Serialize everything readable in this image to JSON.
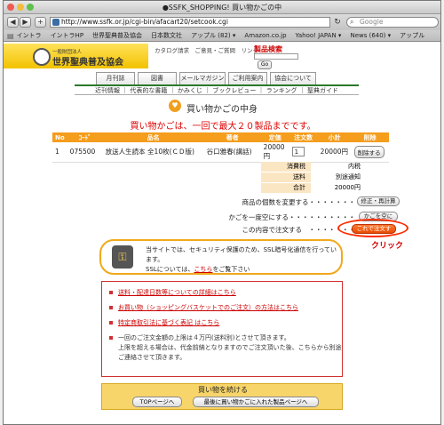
{
  "browser": {
    "window_title": "●SSFK_SHOPPING!  買い物かごの中",
    "url": "http://www.ssfk.or.jp/cgi-bin/afacart20/setcook.cgi",
    "search_placeholder": "Google",
    "back_label": "◀",
    "forward_label": "▶",
    "add_label": "+",
    "reload_label": "↻",
    "bookmarks": [
      "イントラ",
      "イントラHP",
      "世界聖典普及協会",
      "日本数文社",
      "アップル (82) ▾",
      "Amazon.co.jp",
      "Yahoo! JAPAN ▾",
      "News (640) ▾",
      "アップル"
    ]
  },
  "site": {
    "logo_small": "一般財団法人",
    "logo_main": "世界聖典普及協会",
    "header_links": "カタログ請求　ご意見・ご質問　リンク",
    "search_label": "製品検索",
    "search_go": "Go",
    "nav_tabs": [
      "月刊誌",
      "図書",
      "メールマガジン",
      "ご利用案内",
      "協会について"
    ],
    "subnav": "近刊情報 ｜ 代表的な書籍 ｜ かみくじ ｜ ブックレビュー ｜ ランキング ｜ 聖典ガイド"
  },
  "page": {
    "title": "買い物かごの中身",
    "title_icon": "♥",
    "note": "買い物かごは、一回で最大２０製品までです。"
  },
  "cart": {
    "headers": [
      "No",
      "ｺｰﾄﾞ",
      "品名",
      "著者",
      "定価",
      "注文数",
      "小計",
      "削除"
    ],
    "items": [
      {
        "no": "1",
        "code": "075500",
        "name": "放送人生読本 全10枚(ＣＤ版)",
        "author": "谷口雅春(講話)",
        "price": "20000円",
        "qty": "1",
        "subtotal": "20000円",
        "delete": "削除する"
      }
    ],
    "summary": [
      {
        "label": "消費税",
        "value": "内税"
      },
      {
        "label": "送料",
        "value": "別途通知"
      },
      {
        "label": "合計",
        "value": "20000円"
      }
    ]
  },
  "actions": {
    "change_text": "商品の個数を変更する・・・・・・・",
    "change_btn": "修正・再計算",
    "empty_text": "かごを一度空にする・・・・・・・・・・",
    "empty_btn": "かごを空に",
    "order_text": "この内容で注文する　・・・・・・・",
    "order_btn": "これで注文する",
    "click_label": "クリック"
  },
  "security": {
    "line1": "当サイトでは、セキュリティ保護のため、SSL暗号化通信を行っています。",
    "line2_prefix": "SSLについては、",
    "line2_link": "こちら",
    "line2_suffix": "をご覧下さい"
  },
  "notes": {
    "item1": "送料・配達日数等についての詳細はこちら",
    "item2": "お買い物（ショッピングバスケットでのご注文）の方法はこちら",
    "item3": "特定商取引法に基づく表記 はこちら",
    "item4_line1": "一回のご注文金額の上限は４万円(送料別)とさせて頂きます。",
    "item4_line2": "上限を超える場合は、代金前納となりますのでご注文頂いた後、こちらから別途",
    "item4_line3": "ご連絡させて頂きます。"
  },
  "continue": {
    "title": "買い物を続ける",
    "top_btn": "TOPページへ",
    "last_btn": "最後に買い物かごに入れた製品ページへ"
  },
  "colors": {
    "orange": "#f59d1d",
    "red_text": "#e00000",
    "yellow": "#f7d56a"
  }
}
